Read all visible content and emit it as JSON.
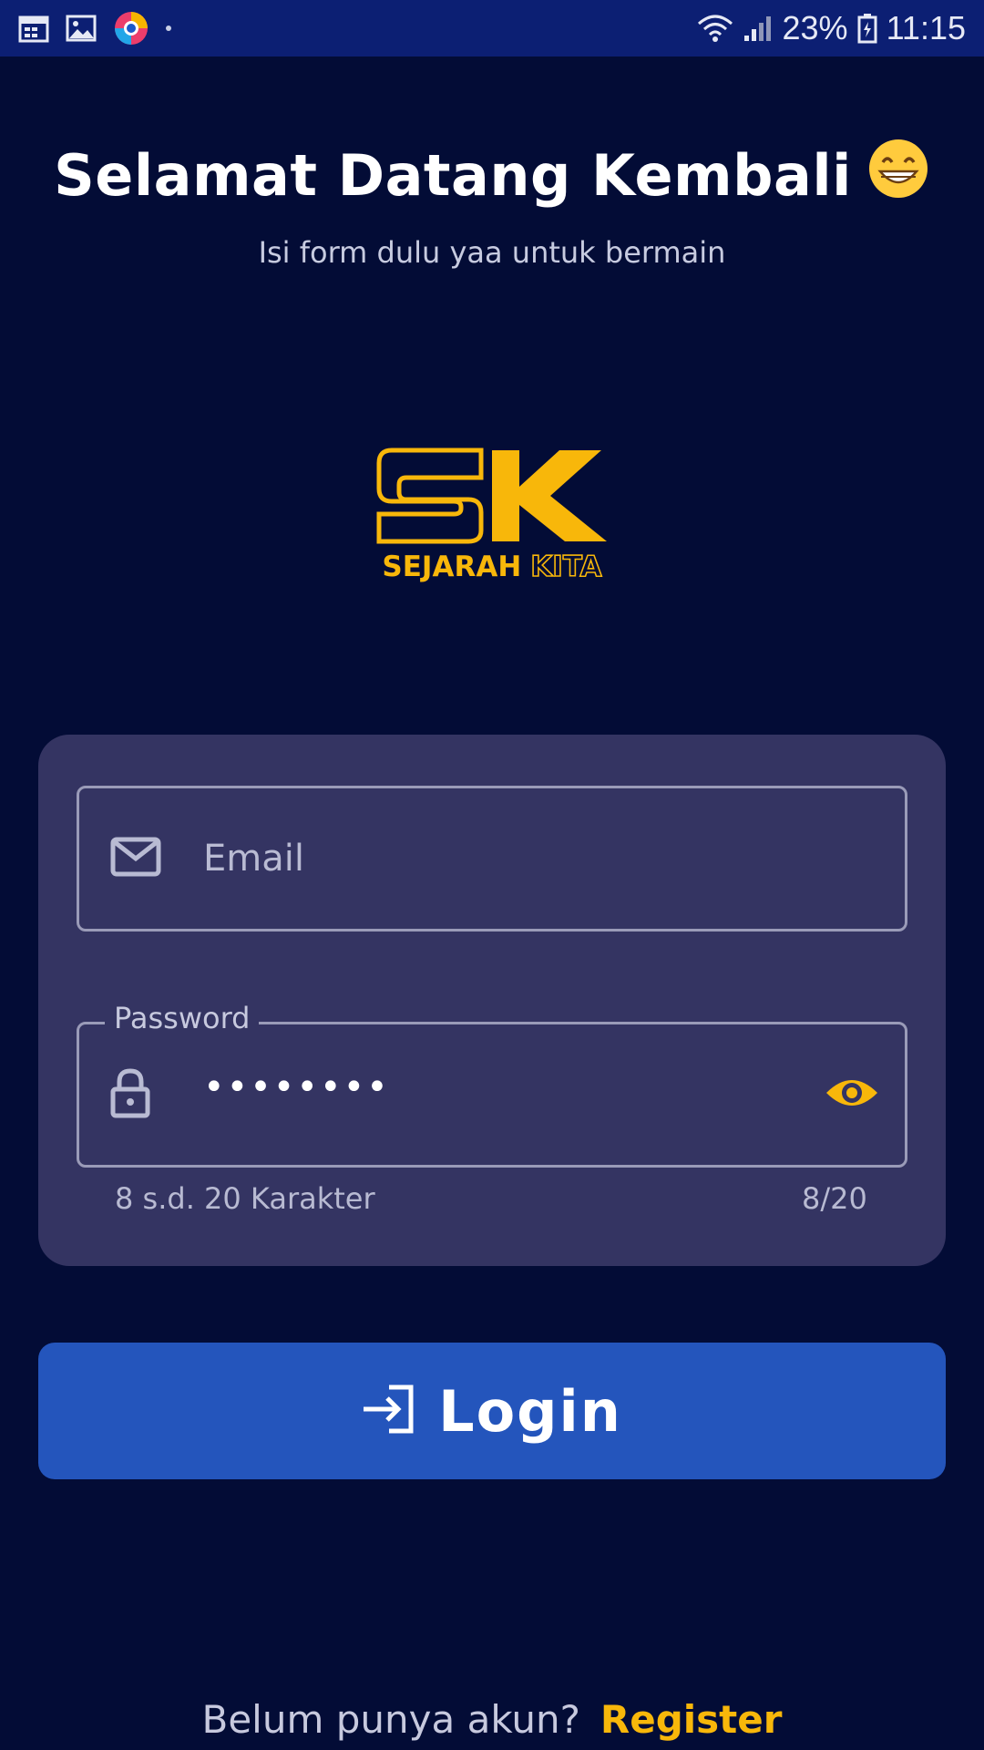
{
  "status_bar": {
    "battery": "23%",
    "time": "11:15",
    "icons_left": [
      "calendar-icon",
      "gallery-icon",
      "browser-icon"
    ],
    "icons_right": [
      "wifi-icon",
      "signal-icon",
      "battery-icon"
    ]
  },
  "header": {
    "title": "Selamat Datang Kembali",
    "emoji": "😁",
    "subtitle": "Isi form dulu yaa untuk bermain"
  },
  "logo": {
    "mark": "SK",
    "word1": "SEJARAH",
    "word2": "KITA"
  },
  "form": {
    "email": {
      "placeholder": "Email",
      "icon": "mail-icon"
    },
    "password": {
      "label": "Password",
      "value": "••••••••",
      "icon": "lock-icon",
      "toggle_icon": "eye-icon",
      "helper": "8 s.d. 20 Karakter",
      "counter": "8/20"
    }
  },
  "login_button": {
    "label": "Login",
    "icon": "login-icon"
  },
  "footer": {
    "question": "Belum punya akun?",
    "register": "Register"
  },
  "colors": {
    "background": "#030c36",
    "status_bar": "#0c1f73",
    "card": "#343462",
    "accent": "#f8b70a",
    "button": "#2455bc"
  }
}
